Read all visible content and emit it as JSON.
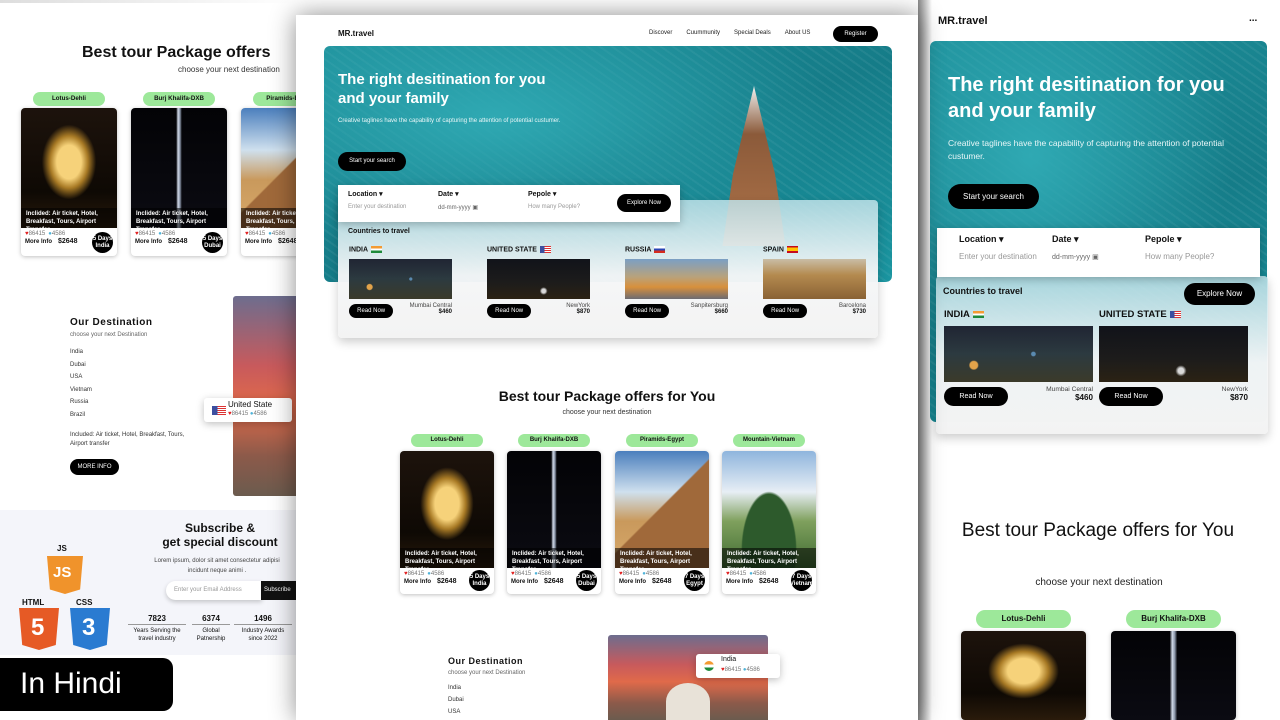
{
  "brand": "MR.travel",
  "nav": [
    "Discover",
    "Cuummunity",
    "Special Deals",
    "About US"
  ],
  "register_label": "Register",
  "more_menu": "...",
  "hero": {
    "title_line1": "The right desitination for you",
    "title_line2": "and your family",
    "tagline": "Creative taglines have the capability of capturing the attention of potential custumer.",
    "cta": "Start your search"
  },
  "search": {
    "location_label": "Location",
    "location_placeholder": "Enter your destination",
    "date_label": "Date",
    "date_placeholder": "dd-mm-yyyy",
    "people_label": "Pepole",
    "people_placeholder": "How many People?",
    "explore": "Explore Now"
  },
  "countries": {
    "heading": "Countries to travel",
    "items": [
      {
        "name": "INDIA",
        "flag": "in",
        "city": "Mumbai Central",
        "price": "$460",
        "button": "Read Now"
      },
      {
        "name": "UNITED STATE",
        "flag": "us",
        "city": "NewYork",
        "price": "$870",
        "button": "Read Now"
      },
      {
        "name": "RUSSIA",
        "flag": "ru",
        "city": "Sanpitersburg",
        "price": "$660",
        "button": "Read Now"
      },
      {
        "name": "SPAIN",
        "flag": "es",
        "city": "Barcelona",
        "price": "$730",
        "button": "Read Now"
      }
    ]
  },
  "packages": {
    "title": "Best tour Package offers for You",
    "title_partial": "Best tour Package offers",
    "subtitle": "choose your next destination",
    "cards": [
      {
        "tag": "Lotus-Dehli",
        "image": "lotus",
        "included": "Inclided: Air ticket, Hotel, Breakfast, Tours, Airport Transfer",
        "likes": "86415",
        "comments": "4586",
        "more": "More Info",
        "price": "$2648",
        "days": "5 Days",
        "place": "India"
      },
      {
        "tag": "Burj Khalifa-DXB",
        "image": "burj",
        "included": "Inclided: Air ticket, Hotel, Breakfast, Tours, Airport Transfer",
        "likes": "86415",
        "comments": "4586",
        "more": "More Info",
        "price": "$2648",
        "days": "5 Days",
        "place": "Dubai"
      },
      {
        "tag": "Piramids-Egypt",
        "image": "pyramid",
        "included": "Inclided: Air ticket, Hotel, Breakfast, Tours, Airport Transfer",
        "likes": "86415",
        "comments": "4586",
        "more": "More Info",
        "price": "$2648",
        "days": "7 Days",
        "place": "Egypt"
      },
      {
        "tag": "Mountain-Vietnam",
        "image": "mountain",
        "included": "Inclided: Air ticket, Hotel, Breakfast, Tours, Airport Transfer",
        "likes": "86415",
        "comments": "4586",
        "more": "More Info",
        "price": "$2648",
        "days": "7 Days",
        "place": "Vietnam"
      }
    ]
  },
  "destination": {
    "title": "Our Destination",
    "subtitle": "choose your next Destination",
    "list": [
      "India",
      "Dubai",
      "USA",
      "Vietnam",
      "Russia",
      "Brazil"
    ],
    "included": "Included: Air ticket, Hotel, Breakfast, Tours, Airport transfer",
    "more_button": "MORE INFO",
    "popup_left": {
      "country": "United State",
      "likes": "86415",
      "comments": "4586"
    },
    "popup_center": {
      "country": "India",
      "likes": "86415",
      "comments": "4586"
    }
  },
  "subscribe": {
    "title_line1": "Subscribe &",
    "title_line2": "get special discount",
    "text_line1": "Lorem ipsum, dolor sit amet consectetur adipisi",
    "text_line2": "incidunt neque animi .",
    "email_placeholder": "Enter your Email Address",
    "button": "Subscribe",
    "stats": [
      {
        "value": "7823",
        "label": "Years Serving the travel industry"
      },
      {
        "value": "6374",
        "label": "Global Patnership"
      },
      {
        "value": "1496",
        "label": "Industry Awards since 2022"
      }
    ]
  },
  "logos": {
    "js": "JS",
    "html": "HTML",
    "css": "CSS",
    "js_digit": "JS",
    "html_digit": "5",
    "css_digit": "3"
  },
  "badge": "In Hindi",
  "colors": {
    "accent_green": "#9de89a",
    "hero_teal": "#1d8e99",
    "heart": "#e01b1b",
    "comment": "#4fb3d9",
    "js": "#f0932b",
    "html": "#e65a25",
    "css": "#2a7bd1"
  }
}
